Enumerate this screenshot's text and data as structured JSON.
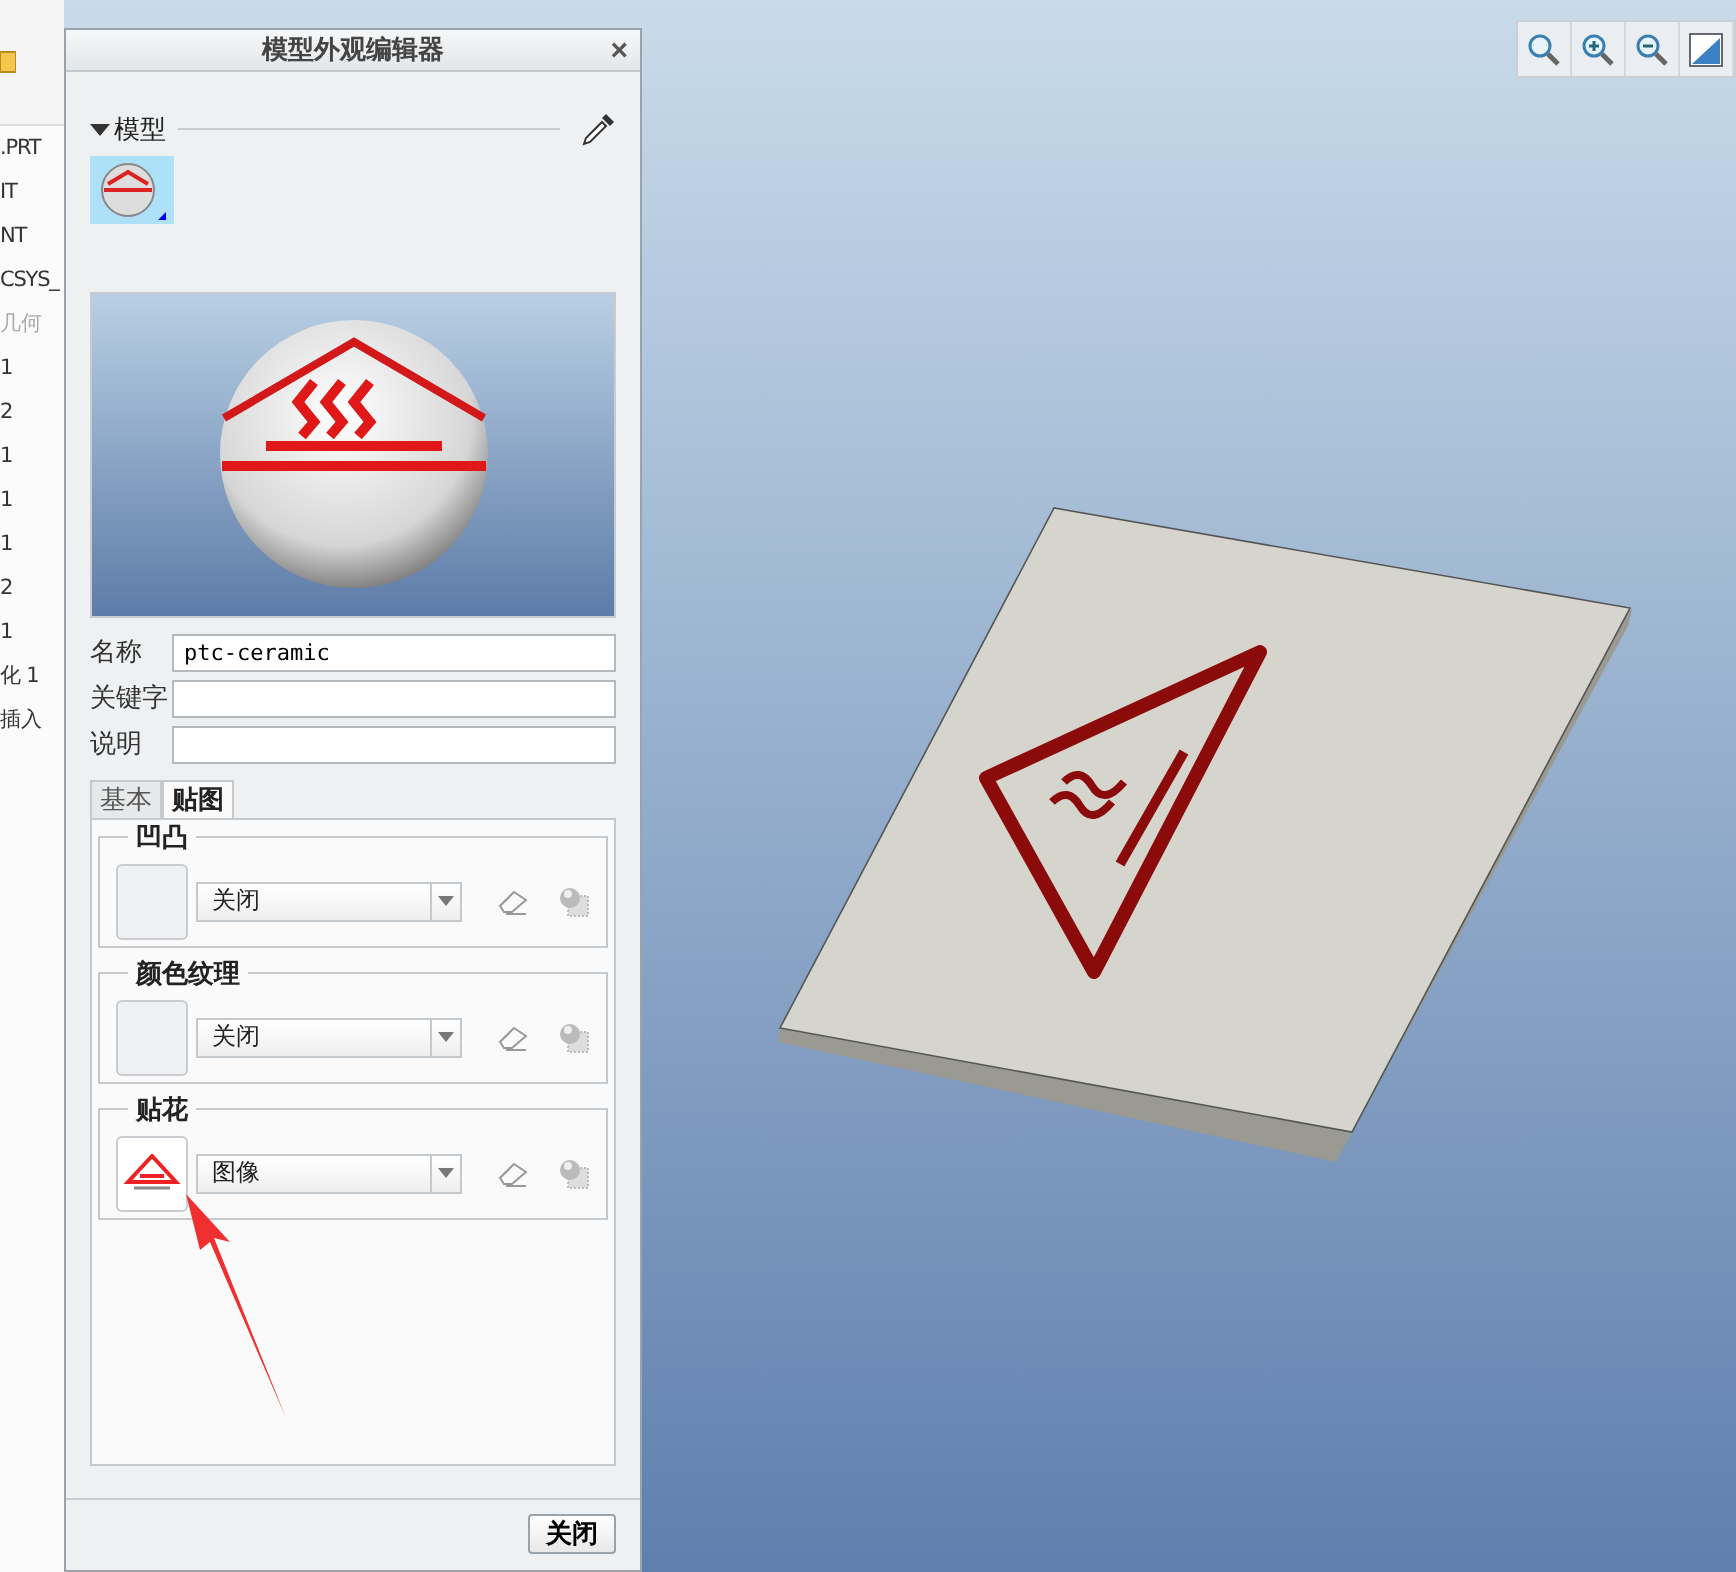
{
  "sidebar": {
    "items": [
      {
        "label": ".PRT",
        "disabled": false
      },
      {
        "label": "IT",
        "disabled": false
      },
      {
        "label": "NT",
        "disabled": false
      },
      {
        "label": "CSYS_",
        "disabled": false
      },
      {
        "label": "几何",
        "disabled": true
      },
      {
        "label": "1",
        "disabled": false
      },
      {
        "label": "2",
        "disabled": false
      },
      {
        "label": "1",
        "disabled": false
      },
      {
        "label": "1",
        "disabled": false
      },
      {
        "label": "1",
        "disabled": false
      },
      {
        "label": "2",
        "disabled": false
      },
      {
        "label": "1",
        "disabled": false
      },
      {
        "label": "化 1",
        "disabled": false
      },
      {
        "label": "插入",
        "disabled": false
      }
    ]
  },
  "dialog": {
    "title": "模型外观编辑器",
    "close": "×",
    "section": {
      "label": "模型",
      "expanded": true
    },
    "fields": [
      {
        "label": "名称",
        "value": "ptc-ceramic"
      },
      {
        "label": "关键字"
      },
      {
        "label": "说明"
      }
    ],
    "tabs": [
      {
        "label": "基本",
        "selected": false
      },
      {
        "label": "贴图",
        "selected": true
      }
    ],
    "groups": [
      {
        "title": "凹凸",
        "value": "关闭",
        "has_image": false
      },
      {
        "title": "颜色纹理",
        "value": "关闭",
        "has_image": false
      },
      {
        "title": "贴花",
        "value": "图像",
        "has_image": true
      }
    ],
    "button": "关闭"
  }
}
